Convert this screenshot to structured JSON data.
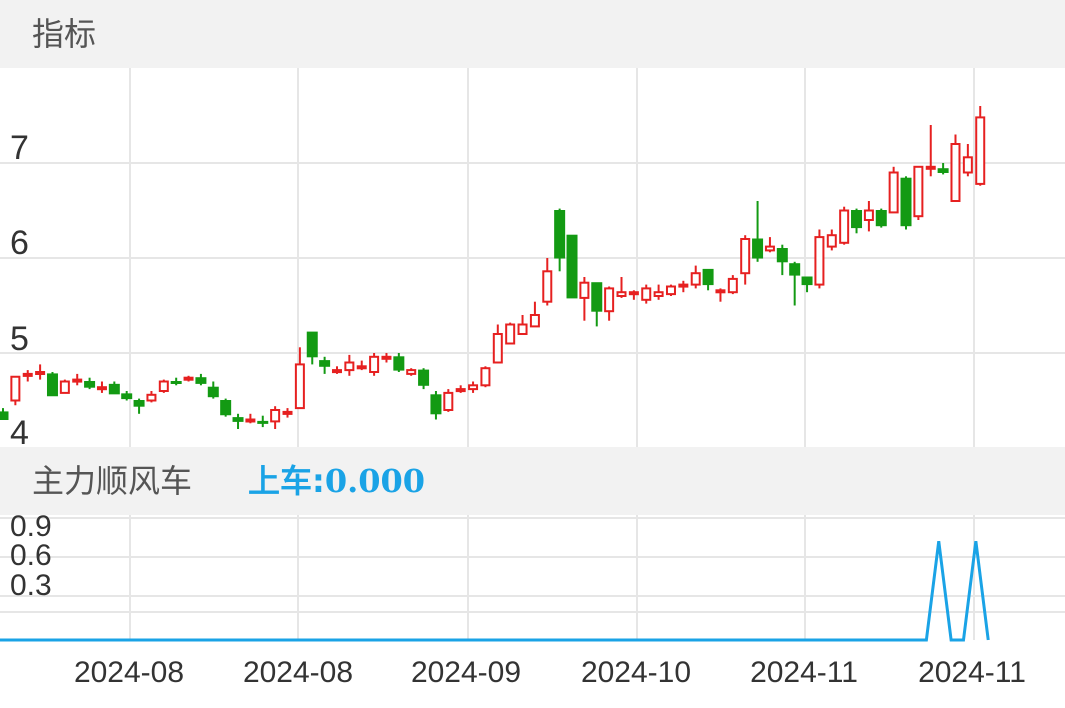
{
  "panel_top": {
    "title": "指标"
  },
  "panel_bottom": {
    "title": "主力顺风车",
    "indicator_label": "上车:",
    "indicator_value": "0.000"
  },
  "colors": {
    "up": "#e62020",
    "down": "#139a13",
    "line": "#1aa3e6",
    "grid": "#e6e6e6",
    "band": "#f2f2f2"
  },
  "chart_data": [
    {
      "type": "candlestick",
      "y_ticks": [
        "4",
        "5",
        "6",
        "7"
      ],
      "ylim": [
        3.8,
        7.7
      ],
      "grid": true,
      "candles": [
        [
          4.38,
          4.3,
          4.42,
          4.3
        ],
        [
          4.5,
          4.75,
          4.75,
          4.45
        ],
        [
          4.78,
          4.78,
          4.82,
          4.7
        ],
        [
          4.78,
          4.8,
          4.88,
          4.72
        ],
        [
          4.78,
          4.55,
          4.8,
          4.55
        ],
        [
          4.58,
          4.7,
          4.72,
          4.58
        ],
        [
          4.72,
          4.72,
          4.78,
          4.66
        ],
        [
          4.7,
          4.64,
          4.74,
          4.62
        ],
        [
          4.62,
          4.64,
          4.7,
          4.58
        ],
        [
          4.67,
          4.57,
          4.7,
          4.57
        ],
        [
          4.57,
          4.52,
          4.6,
          4.5
        ],
        [
          4.5,
          4.44,
          4.52,
          4.36
        ],
        [
          4.5,
          4.56,
          4.6,
          4.48
        ],
        [
          4.6,
          4.7,
          4.72,
          4.58
        ],
        [
          4.7,
          4.69,
          4.74,
          4.66
        ],
        [
          4.72,
          4.74,
          4.76,
          4.7
        ],
        [
          4.74,
          4.68,
          4.78,
          4.66
        ],
        [
          4.64,
          4.54,
          4.7,
          4.52
        ],
        [
          4.5,
          4.35,
          4.52,
          4.33
        ],
        [
          4.32,
          4.28,
          4.36,
          4.2
        ],
        [
          4.28,
          4.3,
          4.36,
          4.26
        ],
        [
          4.28,
          4.26,
          4.34,
          4.22
        ],
        [
          4.28,
          4.4,
          4.44,
          4.2
        ],
        [
          4.36,
          4.38,
          4.42,
          4.32
        ],
        [
          4.42,
          4.88,
          5.06,
          4.42
        ],
        [
          5.22,
          4.96,
          5.22,
          4.88
        ],
        [
          4.92,
          4.86,
          4.96,
          4.78
        ],
        [
          4.82,
          4.82,
          4.86,
          4.78
        ],
        [
          4.82,
          4.9,
          4.98,
          4.76
        ],
        [
          4.86,
          4.86,
          4.92,
          4.82
        ],
        [
          4.8,
          4.96,
          5.0,
          4.76
        ],
        [
          4.96,
          4.96,
          5.0,
          4.9
        ],
        [
          4.96,
          4.82,
          5.0,
          4.8
        ],
        [
          4.78,
          4.82,
          4.84,
          4.76
        ],
        [
          4.82,
          4.66,
          4.84,
          4.62
        ],
        [
          4.56,
          4.36,
          4.6,
          4.3
        ],
        [
          4.4,
          4.58,
          4.62,
          4.38
        ],
        [
          4.6,
          4.62,
          4.66,
          4.58
        ],
        [
          4.62,
          4.66,
          4.7,
          4.58
        ],
        [
          4.66,
          4.84,
          4.86,
          4.64
        ],
        [
          4.9,
          5.2,
          5.3,
          4.9
        ],
        [
          5.1,
          5.3,
          5.32,
          5.1
        ],
        [
          5.2,
          5.3,
          5.4,
          5.2
        ],
        [
          5.28,
          5.4,
          5.54,
          5.28
        ],
        [
          5.54,
          5.86,
          6.0,
          5.5
        ],
        [
          6.5,
          6.0,
          6.52,
          5.86
        ],
        [
          6.24,
          5.58,
          6.24,
          5.58
        ],
        [
          5.58,
          5.74,
          5.8,
          5.34
        ],
        [
          5.74,
          5.44,
          5.74,
          5.28
        ],
        [
          5.44,
          5.68,
          5.7,
          5.34
        ],
        [
          5.6,
          5.64,
          5.8,
          5.58
        ],
        [
          5.62,
          5.64,
          5.66,
          5.56
        ],
        [
          5.56,
          5.68,
          5.72,
          5.52
        ],
        [
          5.6,
          5.64,
          5.72,
          5.56
        ],
        [
          5.62,
          5.7,
          5.72,
          5.6
        ],
        [
          5.72,
          5.72,
          5.76,
          5.64
        ],
        [
          5.72,
          5.84,
          5.92,
          5.68
        ],
        [
          5.88,
          5.72,
          5.88,
          5.66
        ],
        [
          5.66,
          5.66,
          5.68,
          5.54
        ],
        [
          5.64,
          5.78,
          5.82,
          5.62
        ],
        [
          5.84,
          6.2,
          6.24,
          5.72
        ],
        [
          6.2,
          6.0,
          6.6,
          5.96
        ],
        [
          6.08,
          6.12,
          6.22,
          6.06
        ],
        [
          6.1,
          5.96,
          6.14,
          5.82
        ],
        [
          5.94,
          5.82,
          5.96,
          5.5
        ],
        [
          5.8,
          5.72,
          5.8,
          5.64
        ],
        [
          5.72,
          6.22,
          6.3,
          5.68
        ],
        [
          6.12,
          6.24,
          6.3,
          6.08
        ],
        [
          6.16,
          6.5,
          6.54,
          6.14
        ],
        [
          6.5,
          6.32,
          6.52,
          6.26
        ],
        [
          6.4,
          6.5,
          6.6,
          6.28
        ],
        [
          6.5,
          6.34,
          6.52,
          6.32
        ],
        [
          6.48,
          6.9,
          6.96,
          6.48
        ],
        [
          6.84,
          6.34,
          6.86,
          6.3
        ],
        [
          6.44,
          6.96,
          6.96,
          6.4
        ],
        [
          6.94,
          6.96,
          7.4,
          6.86
        ],
        [
          6.94,
          6.9,
          7.0,
          6.88
        ],
        [
          6.6,
          7.2,
          7.3,
          6.6
        ],
        [
          6.9,
          7.06,
          7.2,
          6.86
        ],
        [
          6.78,
          7.48,
          7.6,
          6.76
        ]
      ]
    },
    {
      "type": "line",
      "y_ticks": [
        "0.9",
        "0.6",
        "0.3"
      ],
      "ylim": [
        0,
        1
      ],
      "grid": true,
      "series": [
        {
          "name": "上车",
          "values": [
            0,
            0,
            0,
            0,
            0,
            0,
            0,
            0,
            0,
            0,
            0,
            0,
            0,
            0,
            0,
            0,
            0,
            0,
            0,
            0,
            0,
            0,
            0,
            0,
            0,
            0,
            0,
            0,
            0,
            0,
            0,
            0,
            0,
            0,
            0,
            0,
            0,
            0,
            0,
            0,
            0,
            0,
            0,
            0,
            0,
            0,
            0,
            0,
            0,
            0,
            0,
            0,
            0,
            0,
            0,
            0,
            0,
            0,
            0,
            0,
            0,
            0,
            0,
            0,
            0,
            0,
            0,
            0,
            0,
            0,
            0,
            0,
            0,
            0,
            0,
            0.76,
            0,
            0,
            0.76,
            0
          ]
        }
      ]
    }
  ],
  "x_ticks": [
    "2024-08",
    "2024-08",
    "2024-09",
    "2024-10",
    "2024-11",
    "2024-11"
  ]
}
